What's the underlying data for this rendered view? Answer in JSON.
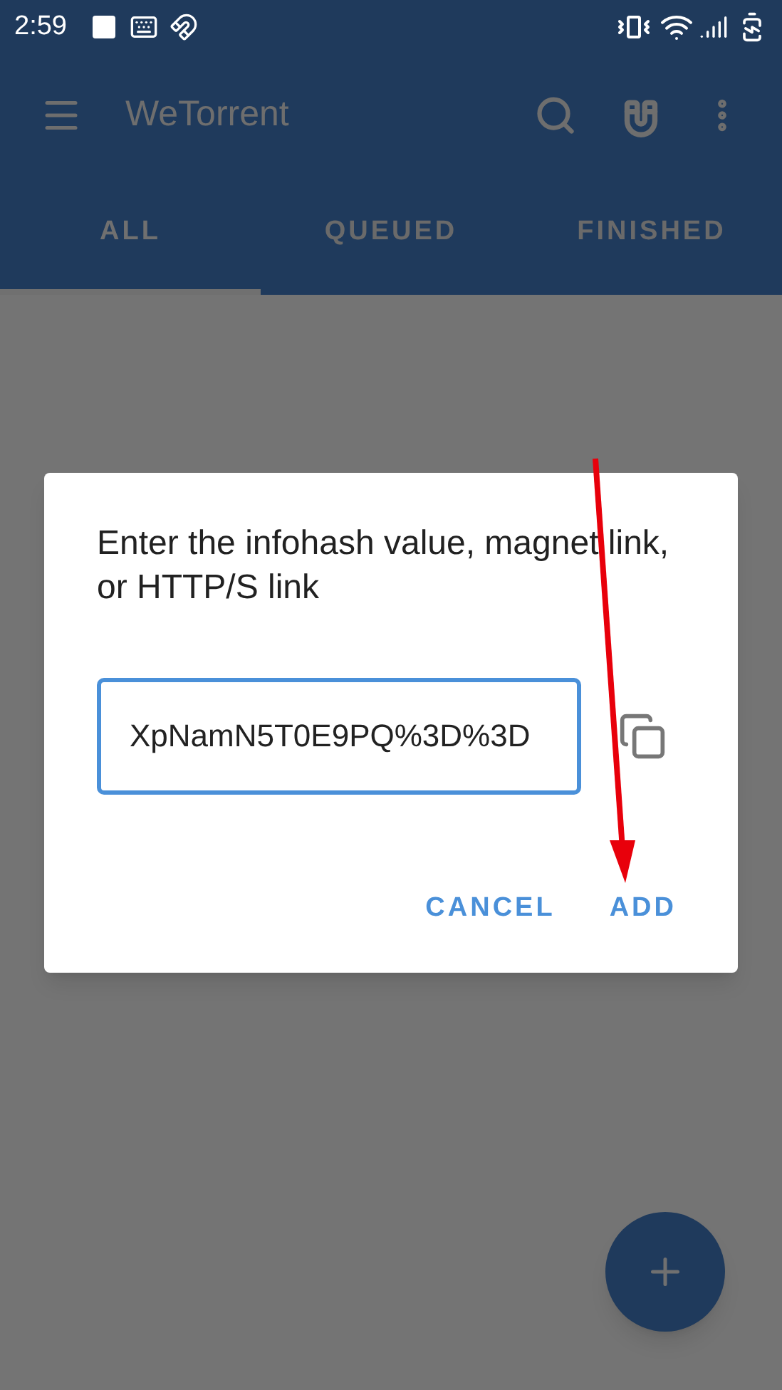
{
  "status_bar": {
    "time": "2:59"
  },
  "app_bar": {
    "title": "WeTorrent"
  },
  "tabs": [
    {
      "label": "ALL",
      "selected": true
    },
    {
      "label": "QUEUED",
      "selected": false
    },
    {
      "label": "FINISHED",
      "selected": false
    }
  ],
  "dialog": {
    "title": "Enter the infohash value, magnet link, or HTTP/S link",
    "field": {
      "value": "XpNamN5T0E9PQ%3D%3D"
    },
    "buttons": [
      "CANCEL",
      "ADD"
    ]
  }
}
